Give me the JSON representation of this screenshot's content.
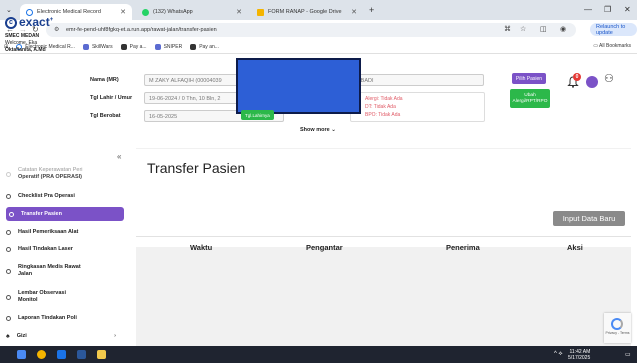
{
  "browser": {
    "tabs": [
      {
        "label": "Electronic Medical Record",
        "active": true,
        "color": "#1a73e8"
      },
      {
        "label": "(132) WhatsApp",
        "active": false,
        "color": "#25d366"
      },
      {
        "label": "FORM RANAP - Google Drive",
        "active": false,
        "color": "#f4b400"
      }
    ],
    "url": "emr-fe-pend-uhf8fgkq-et.a.run.app/rawat-jalan/transfer-pasien",
    "relaunch_label": "Relaunch to update",
    "bookmarks": [
      {
        "label": "Electronic Medical R...",
        "color": "#1a73e8"
      },
      {
        "label": "SkillWars",
        "color": "#5b6bd1"
      },
      {
        "label": "Pay a...",
        "color": "#333333"
      },
      {
        "label": "SNIPER",
        "color": "#5b6bd1"
      },
      {
        "label": "Pay an...",
        "color": "#333333"
      }
    ],
    "all_bookmarks_label": "All Bookmarks"
  },
  "header": {
    "logo_text": "exact",
    "clinic_name": "SMEC MEDAN",
    "welcome_line1": "Welcome, Eka",
    "welcome_line2": "Oktafianita, A.Md",
    "name_label": "Nama (MR)",
    "name_value": "M ZAKY ALFAQIH (00004039",
    "name_suffix": "BBADI",
    "dob_label": "Tgl Lahir / Umur",
    "dob_value": "19-06-2024 / 0 Thn, 10 Bln, 2",
    "berobat_label": "Tgl Berobat",
    "berobat_value": "16-05-2025",
    "tgl_lahirnya_label": "Tgl.Lahirnya",
    "allergy_lines": [
      "Alergi: Tidak Ada",
      "DT: Tidak Ada",
      "BPO: Tidak Ada"
    ],
    "pilih_pasien_label": "Pilih Pasien",
    "ubah_alergi_label": "Ubah Alergi/RPT/RPO",
    "show_more_label": "Show more",
    "notification_count": "0"
  },
  "sidebar": {
    "items": [
      {
        "label": "Catatan Keperawatan Peri",
        "sub": "Operatif (PRA OPERASI)",
        "state": "faded"
      },
      {
        "label": "Checklist Pra Operasi",
        "state": "normal"
      },
      {
        "label": "Transfer Pasien",
        "state": "active"
      },
      {
        "label": "Hasil Pemeriksaan Alat",
        "state": "normal"
      },
      {
        "label": "Hasil Tindakan Laser",
        "state": "normal"
      },
      {
        "label": "Ringkasan Medis Rawat",
        "sub": "Jalan",
        "state": "normal"
      },
      {
        "label": "Lembar Observasi",
        "sub": "Monitol",
        "state": "normal"
      },
      {
        "label": "Laporan Tindakan Poli",
        "state": "normal"
      },
      {
        "label": "Gizi",
        "state": "normal"
      }
    ]
  },
  "main": {
    "title": "Transfer Pasien",
    "input_button_label": "Input Data Baru",
    "columns": [
      "Waktu",
      "Pengantar",
      "Penerima",
      "Aksi"
    ]
  },
  "recaptcha_label": "Privacy - Terms",
  "taskbar": {
    "time": "11:42 AM",
    "date": "5/17/2025"
  }
}
